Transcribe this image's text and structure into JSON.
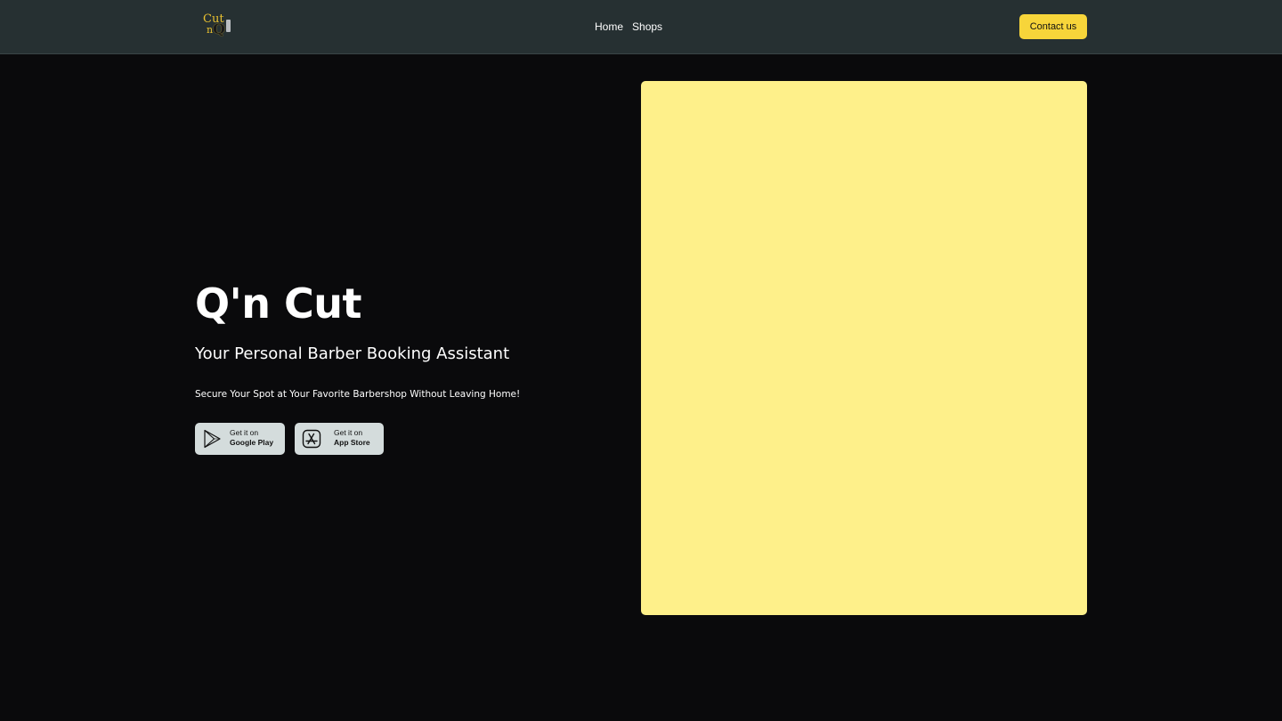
{
  "brand": {
    "logo_icon": "cut-n-q-logo-icon",
    "logo_lines": [
      "Cut",
      "n",
      "Q"
    ]
  },
  "nav": {
    "items": [
      {
        "label": "Home"
      },
      {
        "label": "Shops"
      }
    ],
    "contact_label": "Contact us"
  },
  "hero": {
    "title": "Q'n Cut",
    "subtitle": "Your Personal Barber Booking Assistant",
    "text": "Secure Your Spot at Your Favorite Barbershop Without Leaving Home!",
    "stores": [
      {
        "icon": "google-play-icon",
        "small": "Get it on",
        "big": "Google Play"
      },
      {
        "icon": "app-store-icon",
        "small": "Get it on",
        "big": "App Store"
      }
    ]
  },
  "colors": {
    "nav_bg": "#263032",
    "page_bg": "#0a0a0c",
    "accent": "#f7d53a",
    "panel": "#fef08a",
    "store_button_bg": "#d4dcdc"
  }
}
